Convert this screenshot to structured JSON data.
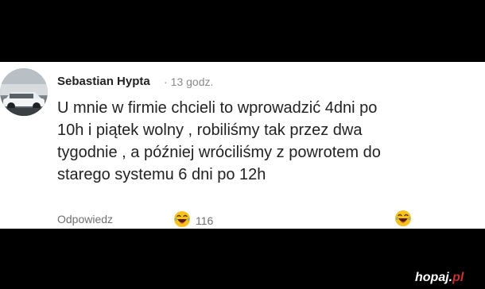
{
  "comment": {
    "author": "Sebastian Hypta",
    "separator": "·",
    "time": "13 godz.",
    "lines": [
      "U mnie w firmie chcieli to wprowadzić  4dni po",
      "10h i piątek wolny , robiliśmy tak przez dwa",
      "tygodnie , a później wróciliśmy z powrotem do",
      "starego systemu 6 dni po 12h"
    ],
    "reply_label": "Odpowiedz",
    "reaction": {
      "icon": "laughing-emoji-icon",
      "count": "116"
    },
    "react_button_icon": "laughing-emoji-icon"
  },
  "watermark": {
    "name": "hopaj",
    "dot": ".",
    "tld": "pl"
  },
  "colors": {
    "background": "#000000",
    "card": "#ffffff",
    "text": "#222222",
    "muted": "#8a8a8a",
    "emoji_yellow": "#f7c21c",
    "watermark_accent": "#c8322e"
  }
}
